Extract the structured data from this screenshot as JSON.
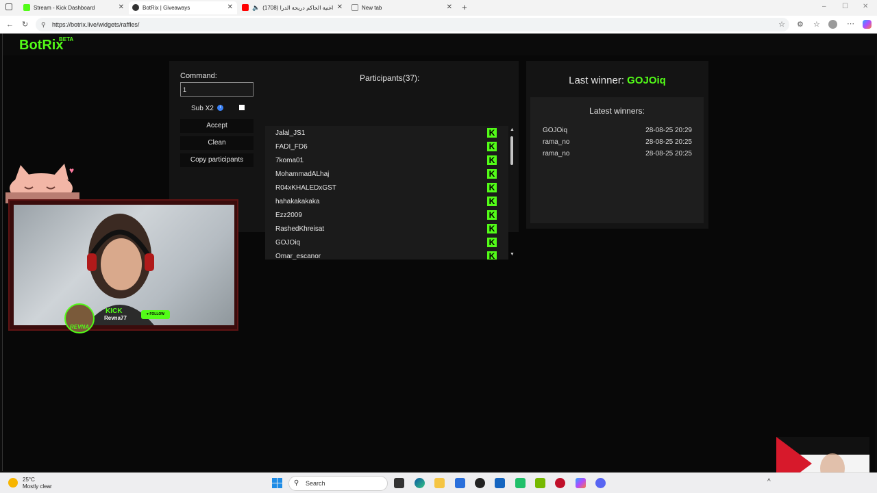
{
  "browser": {
    "tabs": [
      {
        "title": "Stream - Kick Dashboard",
        "active": false,
        "icon_color": "#53fc18"
      },
      {
        "title": "BotRix | Giveaways",
        "active": true,
        "icon_color": "#333333"
      },
      {
        "title": "(1708) اغنية الحاكم دريحة الدرا",
        "active": false,
        "icon_color": "#ff0000"
      },
      {
        "title": "New tab",
        "active": false,
        "icon_color": "#888888"
      }
    ],
    "url": "https://botrix.live/widgets/raffles/"
  },
  "site": {
    "logo": "BotRix",
    "badge": "BETA"
  },
  "raffle": {
    "command_label": "Command:",
    "command_value": "1",
    "sub_label": "Sub X2",
    "sub_checked": false,
    "accept_label": "Accept",
    "clean_label": "Clean",
    "copy_label": "Copy participants",
    "participants_title": "Participants(37):",
    "participants": [
      "Jalal_JS1",
      "FADI_FD6",
      "7koma01",
      "MohammadALhaj",
      "R04xKHALEDxGST",
      "hahakakakaka",
      "Ezz2009",
      "RashedKhreisat",
      "GOJOiq",
      "Omar_escanor"
    ],
    "platform_badge": "K"
  },
  "winners": {
    "last_winner_label": "Last winner:",
    "last_winner_name": "GOJOiq",
    "latest_title": "Latest winners:",
    "latest": [
      {
        "name": "GOJOiq",
        "time": "28-08-25 20:29"
      },
      {
        "name": "rama_no",
        "time": "28-08-25 20:25"
      },
      {
        "name": "rama_no",
        "time": "28-08-25 20:25"
      }
    ]
  },
  "overlay": {
    "platform": "KICK",
    "streamer": "Revna77",
    "follow_label": "FOLLOW",
    "logo_text": "REVNA"
  },
  "taskbar": {
    "temperature": "25°C",
    "weather": "Mostly clear",
    "search_placeholder": "Search"
  },
  "colors": {
    "accent": "#53fc18",
    "panel": "#141414",
    "background": "#080808"
  }
}
